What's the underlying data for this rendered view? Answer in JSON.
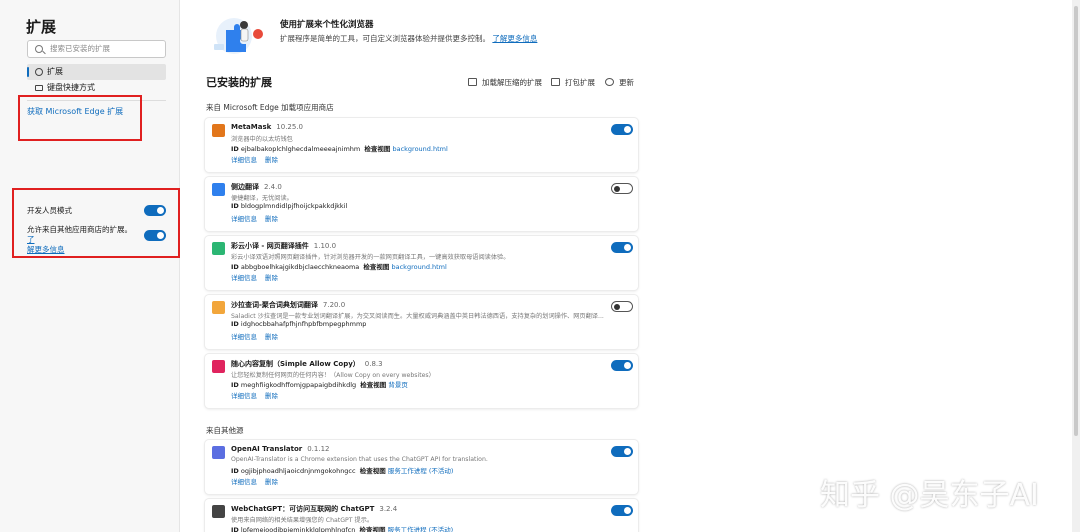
{
  "sidebar": {
    "title": "扩展",
    "search_placeholder": "搜索已安装的扩展",
    "nav": [
      {
        "label": "扩展",
        "icon": "gear-icon"
      },
      {
        "label": "键盘快捷方式",
        "icon": "keyboard-icon"
      }
    ],
    "get_extensions_link": "获取 Microsoft Edge 扩展",
    "developer_mode_label": "开发人员模式",
    "developer_mode_on": true,
    "allow_other_stores_label": "允许来自其他应用商店的扩展。",
    "learn_more_1": "了",
    "learn_more_2": "解更多信息",
    "allow_other_stores_on": true
  },
  "banner": {
    "title": "使用扩展来个性化浏览器",
    "description": "扩展程序是简单的工具，可自定义浏览器体验并提供更多控制。",
    "learn_more": "了解更多信息"
  },
  "main": {
    "installed_title": "已安装的扩展",
    "toolbar": {
      "load_unpacked": "加载解压缩的扩展",
      "pack": "打包扩展",
      "update": "更新"
    },
    "section_store": "来自 Microsoft Edge 加载项应用商店",
    "section_other": "来自其他源",
    "details_label": "详细信息",
    "remove_label": "删除",
    "id_label": "ID",
    "inspect_label": "检查视图"
  },
  "extensions": [
    {
      "name": "MetaMask",
      "version": "10.25.0",
      "desc": "浏览器中的以太坊钱包",
      "id": "ejbalbakoplchlghecdalmeeeajnimhm",
      "inspect": "background.html",
      "enabled": true,
      "logo_color": "#e2761b",
      "icon": "fox-icon"
    },
    {
      "name": "侧边翻译",
      "version": "2.4.0",
      "desc": "便捷翻译，无忧阅读。",
      "id": "bldogplmndidlpjfhoijckpakkdjkkil",
      "inspect": "",
      "enabled": false,
      "logo_color": "#2f80ed",
      "icon": "arrows-icon"
    },
    {
      "name": "彩云小译 - 网页翻译插件",
      "version": "1.10.0",
      "desc": "彩云小译双语对照网页翻译插件，针对浏览器开发的一款网页翻译工具，一键高效获取母语阅读体验。",
      "id": "abbgboelhkajgikdbjclaecchkneaoma",
      "inspect": "background.html",
      "enabled": true,
      "logo_color": "#2bb673",
      "icon": "caiyun-icon"
    },
    {
      "name": "沙拉查词-聚合词典划词翻译",
      "version": "7.20.0",
      "desc": "Saladict 沙拉查词是一款专业划词翻译扩展，为交叉阅读而生。大量权威词典涵盖中英日韩法德西语，支持复杂的划词操作、网页翻译...",
      "id": "idghocbbahafpfhjnfhpbfbmpegphmmp",
      "inspect": "",
      "enabled": false,
      "logo_color": "#f2a63b",
      "icon": "salad-icon"
    },
    {
      "name": "随心内容复制（Simple Allow Copy）",
      "version": "0.8.3",
      "desc": "让您轻松复制任何网页的任何内容！（Allow Copy on every websites）",
      "id": "meghfiigkodhffomjgpapaigbdihkdlg",
      "inspect": "背景页",
      "enabled": true,
      "logo_color": "#e0245e",
      "icon": "copy-icon"
    },
    {
      "name": "OpenAI Translator",
      "version": "0.1.12",
      "desc": "OpenAI-Translator is a Chrome extension that uses the ChatGPT API for translation.",
      "id": "ogjibjphoadhljaoicdnjnmgokohngcc",
      "inspect": "服务工作进程 (不活动)",
      "enabled": true,
      "logo_color": "#5b6ee1",
      "icon": "openai-icon"
    },
    {
      "name": "WebChatGPT：可访问互联网的 ChatGPT",
      "version": "3.2.4",
      "desc": "使用来自网络的相关结果增强您的 ChatGPT 提示。",
      "id": "lpfemeioodjbpieminkklglpmhlngfcn",
      "inspect": "服务工作进程 (不活动)",
      "enabled": true,
      "logo_color": "#444444",
      "icon": "webchatgpt-icon"
    }
  ],
  "watermark": "知乎 @吴东子AI"
}
